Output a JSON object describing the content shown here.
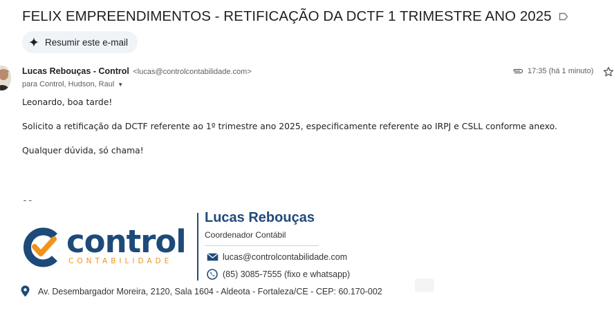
{
  "subject": "FELIX EMPREENDIMENTOS - RETIFICAÇÃO DA DCTF 1 TRIMESTRE ANO 2025",
  "summary_button": "Resumir este e-mail",
  "sender": {
    "name": "Lucas Rebouças - Control",
    "email": "<lucas@controlcontabilidade.com>",
    "recipients": "para Control, Hudson, Raul"
  },
  "meta": {
    "time": "17:35 (há 1 minuto)"
  },
  "body": {
    "greeting": "Leonardo, boa tarde!",
    "paragraph": "Solicito a retificação da DCTF referente ao 1º trimestre ano 2025, especificamente referente ao IRPJ e CSLL conforme anexo.",
    "closing": "Qualquer dúvida, só chama!"
  },
  "signature": {
    "dash": "--",
    "logo_word": "control",
    "logo_sub": "CONTABILIDADE",
    "name": "Lucas Rebouças",
    "role": "Coordenador Contábil",
    "email": "lucas@controlcontabilidade.com",
    "phone": "(85) 3085-7555 (fixo e whatsapp)",
    "address": "Av. Desembargador Moreira, 2120, Sala 1604 - Aldeota - Fortaleza/CE - CEP: 60.170-002"
  },
  "colors": {
    "brand_blue": "#1e4a7a",
    "brand_orange": "#f0931e",
    "chip_bg": "#f0f4f9"
  },
  "icons": [
    "label-icon",
    "sparkle-icon",
    "paperclip-icon",
    "star-icon",
    "chevron-down-icon",
    "envelope-icon",
    "whatsapp-icon",
    "location-pin-icon"
  ]
}
